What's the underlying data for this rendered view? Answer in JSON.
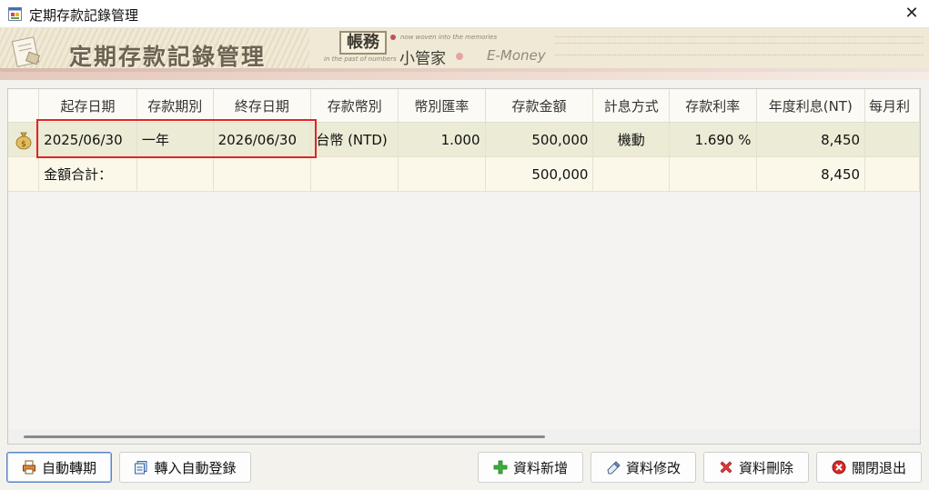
{
  "window": {
    "title": "定期存款記錄管理",
    "close_glyph": "✕"
  },
  "banner": {
    "title": "定期存款記錄管理",
    "logo_char": "帳務",
    "subtitle": "小管家",
    "tagline_top": "now woven into the memories",
    "tagline_bottom": "in the past of numbers",
    "brand": "E-Money"
  },
  "grid": {
    "columns": [
      "起存日期",
      "存款期別",
      "終存日期",
      "存款幣別",
      "幣別匯率",
      "存款金額",
      "計息方式",
      "存款利率",
      "年度利息(NT)",
      "每月利"
    ],
    "rows": [
      {
        "start_date": "2025/06/30",
        "term": "一年",
        "end_date": "2026/06/30",
        "currency": "台幣 (NTD)",
        "rate": "1.000",
        "amount": "500,000",
        "interest_method": "機動",
        "interest_rate": "1.690 %",
        "annual_interest": "8,450",
        "monthly_interest": ""
      }
    ],
    "total": {
      "label": "金額合計：",
      "amount": "500,000",
      "annual_interest": "8,450"
    }
  },
  "buttons": {
    "auto_renew": "自動轉期",
    "import_auto": "轉入自動登錄",
    "add": "資料新增",
    "edit": "資料修改",
    "delete": "資料刪除",
    "exit": "關閉退出"
  },
  "icons": {
    "app": "app-window-icon",
    "row": "money-bag-icon",
    "add": "plus-icon",
    "edit": "eraser-icon",
    "delete": "x-icon",
    "exit": "close-circle-icon"
  }
}
